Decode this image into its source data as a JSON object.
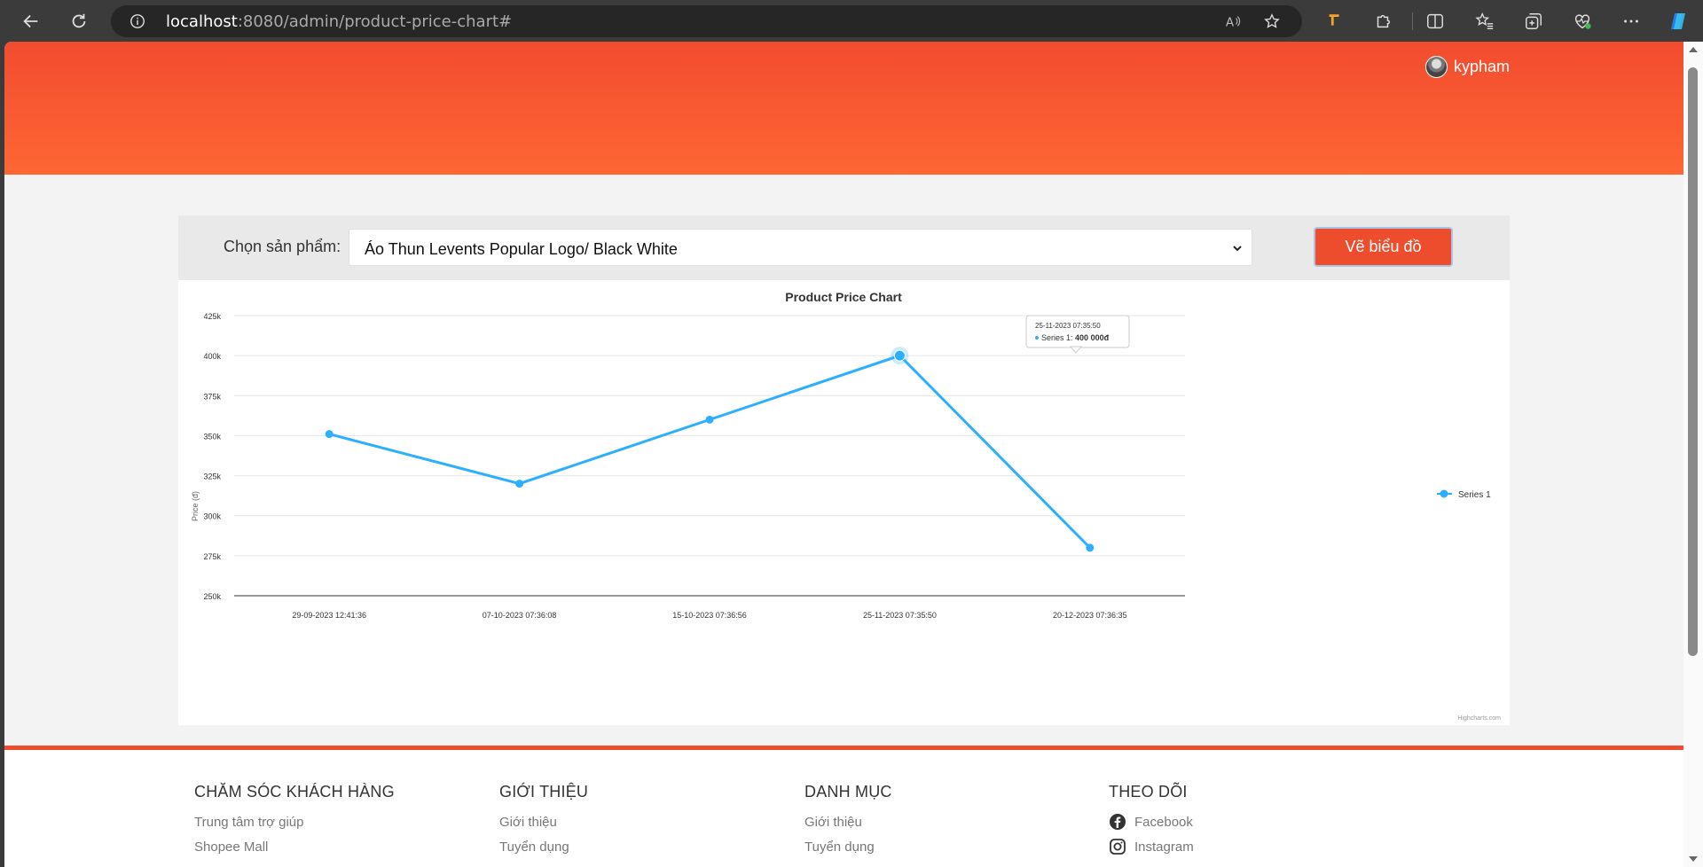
{
  "browser": {
    "url_host": "localhost",
    "url_path": ":8080/admin/product-price-chart#"
  },
  "header": {
    "username": "kypham"
  },
  "controls": {
    "label": "Chọn sản phẩm:",
    "selected_product": "Áo Thun Levents Popular Logo/ Black White",
    "draw_button": "Vẽ biểu đồ"
  },
  "chart_data": {
    "type": "line",
    "title": "Product Price Chart",
    "ylabel": "Price (đ)",
    "xlabel": "",
    "categories": [
      "29-09-2023 12:41:36",
      "07-10-2023 07:36:08",
      "15-10-2023 07:36:56",
      "25-11-2023 07:35:50",
      "20-12-2023 07:36:35"
    ],
    "series": [
      {
        "name": "Series 1",
        "values": [
          351000,
          320000,
          360000,
          400000,
          280000
        ],
        "color": "#2caffe"
      }
    ],
    "ylim": [
      250000,
      425000
    ],
    "yticks": [
      "250k",
      "275k",
      "300k",
      "325k",
      "350k",
      "375k",
      "400k",
      "425k"
    ],
    "tooltip": {
      "header": "25-11-2023 07:35:50",
      "series_label": "Series 1:",
      "value": "400 000đ"
    },
    "credits": "Highcharts.com",
    "legend_position": "right",
    "grid": true
  },
  "footer": {
    "columns": [
      {
        "title": "CHĂM SÓC KHÁCH HÀNG",
        "links": [
          "Trung tâm trợ giúp",
          "Shopee Mall"
        ]
      },
      {
        "title": "GIỚI THIỆU",
        "links": [
          "Giới thiệu",
          "Tuyển dụng"
        ]
      },
      {
        "title": "DANH MỤC",
        "links": [
          "Giới thiệu",
          "Tuyển dụng"
        ]
      },
      {
        "title": "THEO DÕI",
        "links": [
          "Facebook",
          "Instagram"
        ]
      }
    ]
  }
}
